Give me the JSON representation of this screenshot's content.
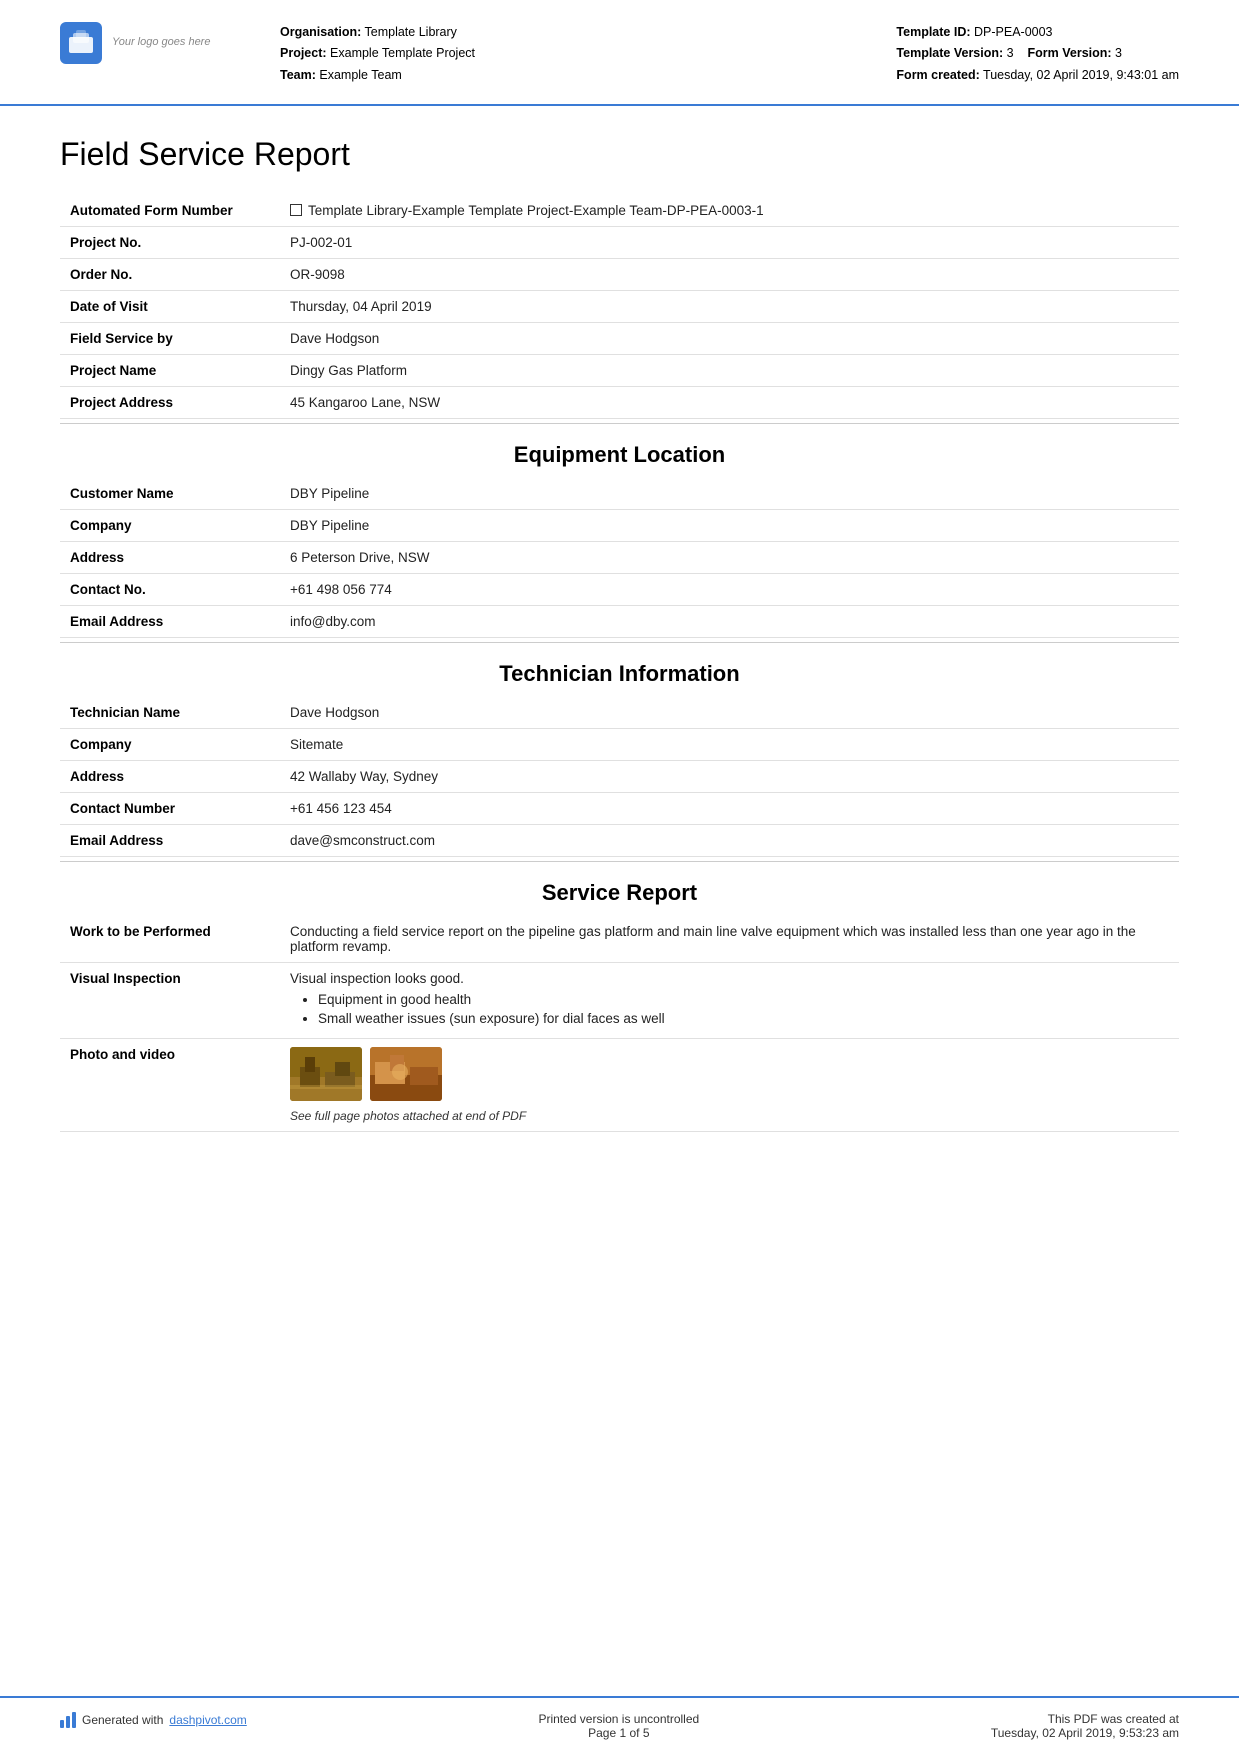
{
  "header": {
    "logo_alt": "Your logo goes here",
    "organisation_label": "Organisation:",
    "organisation_value": "Template Library",
    "project_label": "Project:",
    "project_value": "Example Template Project",
    "team_label": "Team:",
    "team_value": "Example Team",
    "template_id_label": "Template ID:",
    "template_id_value": "DP-PEA-0003",
    "template_version_label": "Template Version:",
    "template_version_value": "3",
    "form_version_label": "Form Version:",
    "form_version_value": "3",
    "form_created_label": "Form created:",
    "form_created_value": "Tuesday, 02 April 2019, 9:43:01 am"
  },
  "document": {
    "title": "Field Service Report"
  },
  "info_rows": [
    {
      "label": "Automated Form Number",
      "value": "Template Library-Example Template Project-Example Team-DP-PEA-0003-1",
      "has_checkbox": true
    },
    {
      "label": "Project No.",
      "value": "PJ-002-01",
      "has_checkbox": false
    },
    {
      "label": "Order No.",
      "value": "OR-9098",
      "has_checkbox": false
    },
    {
      "label": "Date of Visit",
      "value": "Thursday, 04 April 2019",
      "has_checkbox": false
    },
    {
      "label": "Field Service by",
      "value": "Dave Hodgson",
      "has_checkbox": false
    },
    {
      "label": "Project Name",
      "value": "Dingy Gas Platform",
      "has_checkbox": false
    },
    {
      "label": "Project Address",
      "value": "45 Kangaroo Lane, NSW",
      "has_checkbox": false
    }
  ],
  "equipment_location": {
    "heading": "Equipment Location",
    "rows": [
      {
        "label": "Customer Name",
        "value": "DBY Pipeline"
      },
      {
        "label": "Company",
        "value": "DBY Pipeline"
      },
      {
        "label": "Address",
        "value": "6 Peterson Drive, NSW"
      },
      {
        "label": "Contact No.",
        "value": "+61 498 056 774"
      },
      {
        "label": "Email Address",
        "value": "info@dby.com"
      }
    ]
  },
  "technician_information": {
    "heading": "Technician Information",
    "rows": [
      {
        "label": "Technician Name",
        "value": "Dave Hodgson"
      },
      {
        "label": "Company",
        "value": "Sitemate"
      },
      {
        "label": "Address",
        "value": "42 Wallaby Way, Sydney"
      },
      {
        "label": "Contact Number",
        "value": "+61 456 123 454"
      },
      {
        "label": "Email Address",
        "value": "dave@smconstruct.com"
      }
    ]
  },
  "service_report": {
    "heading": "Service Report",
    "rows": [
      {
        "label": "Work to be Performed",
        "value": "Conducting a field service report on the pipeline gas platform and main line valve equipment which was installed less than one year ago in the platform revamp.",
        "bullets": []
      },
      {
        "label": "Visual Inspection",
        "value": "Visual inspection looks good.",
        "bullets": [
          "Equipment in good health",
          "Small weather issues (sun exposure) for dial faces as well"
        ]
      },
      {
        "label": "Photo and video",
        "value": "",
        "bullets": [],
        "has_photos": true,
        "photo_caption": "See full page photos attached at end of PDF"
      }
    ]
  },
  "footer": {
    "generated_text": "Generated with",
    "generated_link": "dashpivot.com",
    "middle_line1": "Printed version is uncontrolled",
    "middle_line2": "Page 1 of 5",
    "right_line1": "This PDF was created at",
    "right_line2": "Tuesday, 02 April 2019, 9:53:23 am"
  }
}
